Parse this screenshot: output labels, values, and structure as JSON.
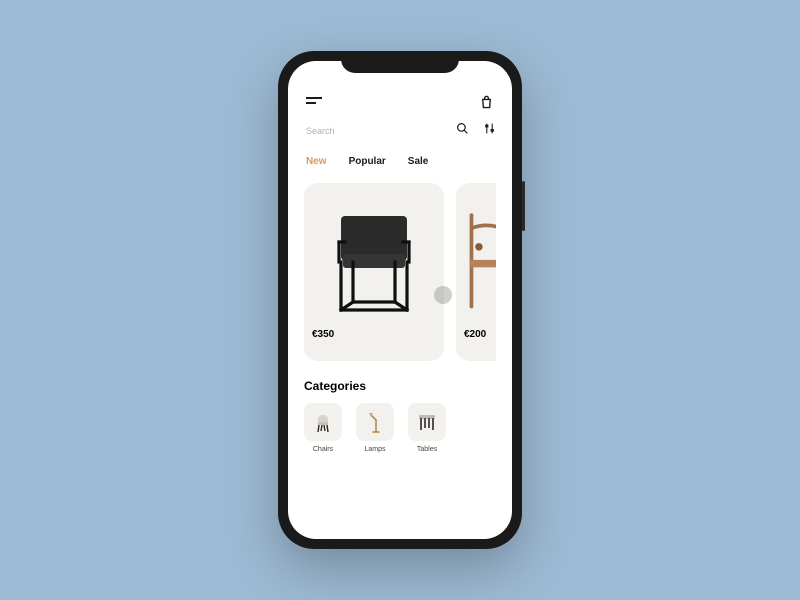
{
  "search": {
    "placeholder": "Search"
  },
  "tabs": {
    "new": "New",
    "popular": "Popular",
    "sale": "Sale"
  },
  "products": [
    {
      "price": "€350"
    },
    {
      "price": "€200"
    }
  ],
  "categories": {
    "title": "Categories",
    "items": [
      {
        "label": "Chairs"
      },
      {
        "label": "Lamps"
      },
      {
        "label": "Tables"
      }
    ]
  }
}
